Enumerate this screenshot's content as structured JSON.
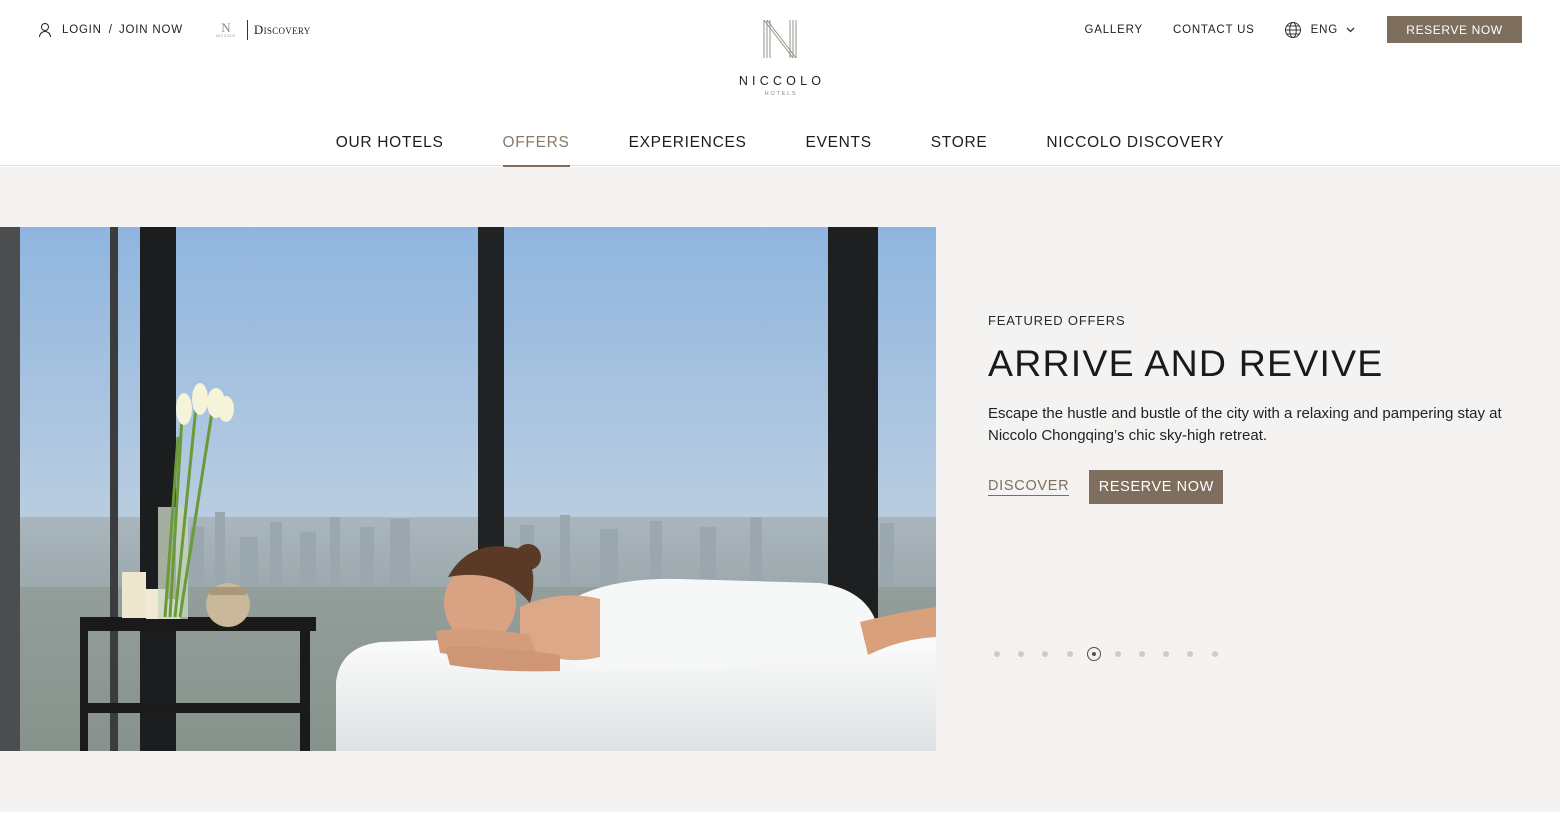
{
  "utility": {
    "login": "LOGIN",
    "separator": "/",
    "join": "JOIN NOW",
    "discovery_logo": "Discovery"
  },
  "brand": {
    "name": "NICCOLO",
    "sub": "HOTELS"
  },
  "utility_right": {
    "gallery": "GALLERY",
    "contact": "CONTACT US",
    "language": "ENG",
    "reserve": "RESERVE NOW"
  },
  "nav": {
    "items": [
      {
        "label": "OUR HOTELS"
      },
      {
        "label": "OFFERS"
      },
      {
        "label": "EXPERIENCES"
      },
      {
        "label": "EVENTS"
      },
      {
        "label": "STORE"
      },
      {
        "label": "NICCOLO DISCOVERY"
      }
    ],
    "active_index": 1
  },
  "hero": {
    "eyebrow": "FEATURED OFFERS",
    "title": "ARRIVE AND REVIVE",
    "description": "Escape the hustle and bustle of the city with a relaxing and pampering stay at Niccolo Chongqing’s chic sky-high retreat.",
    "discover": "DISCOVER",
    "reserve": "RESERVE NOW",
    "carousel": {
      "total": 10,
      "active_index": 4
    }
  },
  "icons": {
    "user": "user-icon",
    "globe": "globe-icon",
    "chevron": "chevron-down-icon"
  },
  "colors": {
    "accent": "#7d6e5e",
    "hero_bg": "#f4f3f1",
    "text": "#1d1d1d"
  }
}
